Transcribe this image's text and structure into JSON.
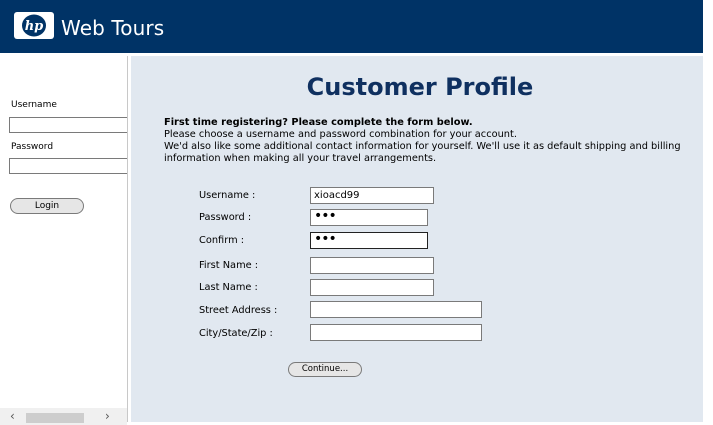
{
  "header": {
    "logo_text": "hp",
    "brand": "Web Tours",
    "colors": {
      "header_bg": "#003366",
      "title": "#0f3060",
      "panel_bg": "#e1e8f0"
    }
  },
  "sidebar": {
    "username_label": "Username",
    "username_value": "",
    "password_label": "Password",
    "password_value": "",
    "login_label": "Login",
    "scroll_left_icon": "chevron-left-icon",
    "scroll_right_icon": "chevron-right-icon"
  },
  "main": {
    "title": "Customer Profile",
    "intro_heading": "First time registering? Please complete the form below.",
    "intro_line1": "Please choose a username and password combination for your account.",
    "intro_line2": "We'd also like some additional contact information for yourself. We'll use it as default shipping and billing information when making all your travel arrangements.",
    "form": {
      "username_label": "Username :",
      "username_value": "xioacd99",
      "password_label": "Password :",
      "password_value": "•••",
      "confirm_label": "Confirm :",
      "confirm_value": "•••",
      "first_name_label": "First Name :",
      "first_name_value": "",
      "last_name_label": "Last Name :",
      "last_name_value": "",
      "street_label": "Street Address :",
      "street_value": "",
      "city_label": "City/State/Zip :",
      "city_value": ""
    },
    "continue_label": "Continue..."
  }
}
